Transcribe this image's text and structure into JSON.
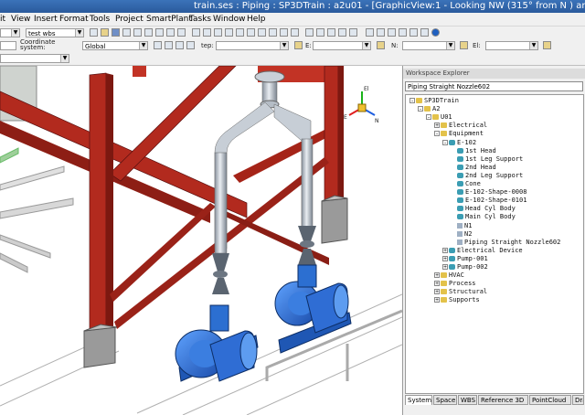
{
  "window": {
    "title": "train.ses : Piping : SP3DTrain : a2u01 - [GraphicView:1 - Looking NW (315° from N ) and 35°"
  },
  "menu": [
    "it",
    "View",
    "Insert",
    "Format",
    "Tools",
    "Project",
    "SmartPlant",
    "Tasks",
    "Window",
    "Help"
  ],
  "toolbar": {
    "filter_value": "test wbs",
    "coord_label": "Coordinate system:",
    "coord_value": "Global",
    "field1_label": "tep:",
    "field2_label": "E:",
    "field3_label": "N:",
    "field4_label": "El:"
  },
  "explorer": {
    "header": "Workspace Explorer",
    "path": "Piping Straight Nozzle602",
    "tree": [
      {
        "label": "SP3DTrain",
        "level": 0,
        "toggle": "-",
        "icon": "folder"
      },
      {
        "label": "A2",
        "level": 1,
        "toggle": "-",
        "icon": "folder"
      },
      {
        "label": "U01",
        "level": 2,
        "toggle": "-",
        "icon": "folder"
      },
      {
        "label": "Electrical",
        "level": 3,
        "toggle": "+",
        "icon": "folder"
      },
      {
        "label": "Equipment",
        "level": 3,
        "toggle": "-",
        "icon": "folder"
      },
      {
        "label": "E-102",
        "level": 4,
        "toggle": "-",
        "icon": "equip"
      },
      {
        "label": "1st Head",
        "level": 5,
        "toggle": "",
        "icon": "equip"
      },
      {
        "label": "1st Leg Support",
        "level": 5,
        "toggle": "",
        "icon": "equip"
      },
      {
        "label": "2nd Head",
        "level": 5,
        "toggle": "",
        "icon": "equip"
      },
      {
        "label": "2nd Leg Support",
        "level": 5,
        "toggle": "",
        "icon": "equip"
      },
      {
        "label": "Cone",
        "level": 5,
        "toggle": "",
        "icon": "equip"
      },
      {
        "label": "E-102-Shape-0008",
        "level": 5,
        "toggle": "",
        "icon": "equip"
      },
      {
        "label": "E-102-Shape-0101",
        "level": 5,
        "toggle": "",
        "icon": "equip"
      },
      {
        "label": "Head Cyl Body",
        "level": 5,
        "toggle": "",
        "icon": "equip"
      },
      {
        "label": "Main Cyl Body",
        "level": 5,
        "toggle": "",
        "icon": "equip"
      },
      {
        "label": "N1",
        "level": 5,
        "toggle": "",
        "icon": "nozzle"
      },
      {
        "label": "N2",
        "level": 5,
        "toggle": "",
        "icon": "nozzle"
      },
      {
        "label": "Piping Straight Nozzle602",
        "level": 5,
        "toggle": "",
        "icon": "nozzle"
      },
      {
        "label": "Electrical Device",
        "level": 4,
        "toggle": "+",
        "icon": "equip"
      },
      {
        "label": "Pump-001",
        "level": 4,
        "toggle": "+",
        "icon": "equip"
      },
      {
        "label": "Pump-002",
        "level": 4,
        "toggle": "+",
        "icon": "equip"
      },
      {
        "label": "HVAC",
        "level": 3,
        "toggle": "+",
        "icon": "folder"
      },
      {
        "label": "Process",
        "level": 3,
        "toggle": "+",
        "icon": "folder"
      },
      {
        "label": "Structural",
        "level": 3,
        "toggle": "+",
        "icon": "folder"
      },
      {
        "label": "Supports",
        "level": 3,
        "toggle": "+",
        "icon": "folder"
      }
    ],
    "tabs": [
      "System",
      "Space",
      "WBS",
      "Reference 3D",
      "PointCloud",
      "Dra"
    ]
  },
  "view_axes": {
    "x_label": "E",
    "y_label": "N",
    "z_label": "El"
  },
  "colors": {
    "steel_red": "#b22a1e",
    "pump_blue": "#2c6fd1",
    "pipe_grey": "#aab2bd",
    "concrete": "#9a9a9a"
  }
}
